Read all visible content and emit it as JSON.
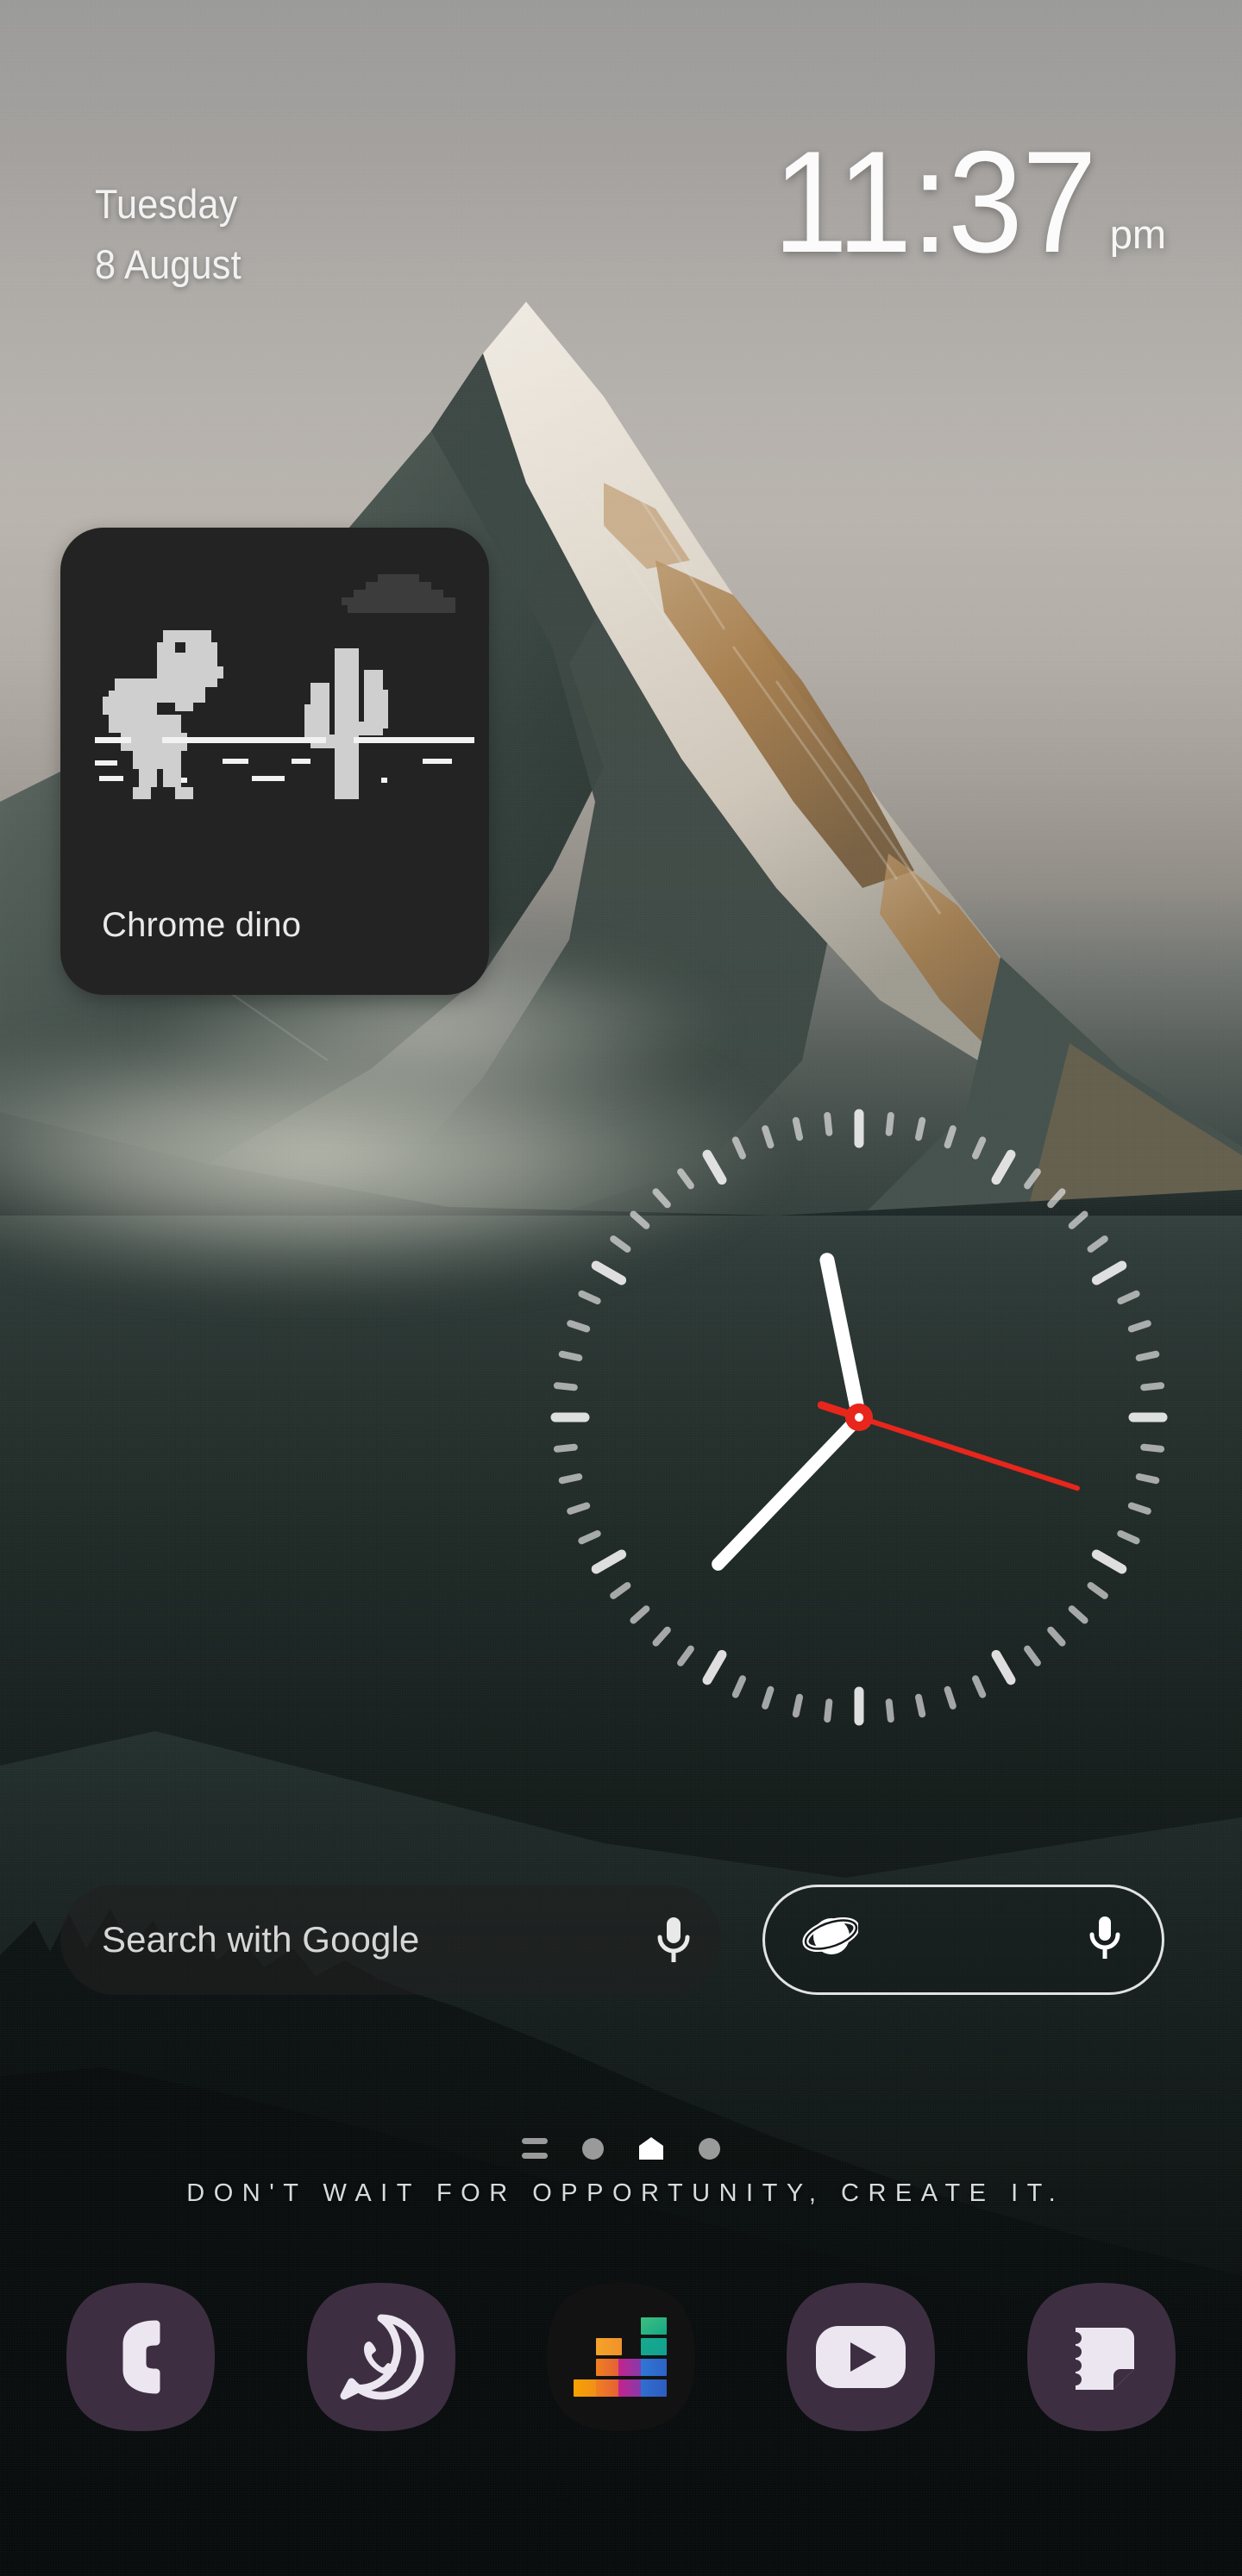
{
  "wallpaper": {
    "description": "mountain-peak-photo",
    "sky_color": "#b4b0ab",
    "forest_color": "#0d1615"
  },
  "status_clock": {
    "weekday": "Tuesday",
    "date": "8 August",
    "time": "11:37",
    "ampm": "pm"
  },
  "dino_widget": {
    "label": "Chrome dino",
    "background": "#232323",
    "sprite_color": "#cfcfcf"
  },
  "analog_clock": {
    "hour": 11,
    "minute": 37,
    "second": 18,
    "hand_color": "#ffffff",
    "second_hand_color": "#e8261c",
    "tick_color": "#e6e6e6"
  },
  "search": {
    "google_placeholder": "Search with Google",
    "google_mic_icon": "microphone-icon",
    "browser_icon": "samsung-internet-icon",
    "browser_mic_icon": "microphone-icon"
  },
  "page_indicator": {
    "items": [
      {
        "type": "app-list-bars",
        "active": false
      },
      {
        "type": "dot",
        "active": false
      },
      {
        "type": "home",
        "active": true
      },
      {
        "type": "dot",
        "active": false
      }
    ]
  },
  "quote": {
    "text": "DON'T WAIT FOR OPPORTUNITY, CREATE IT."
  },
  "dock": {
    "icon_bg": "#3d2f41",
    "glyph_color": "#ece6f0",
    "items": [
      {
        "name": "phone",
        "label": "Phone",
        "icon": "phone-icon"
      },
      {
        "name": "whatsapp",
        "label": "WhatsApp",
        "icon": "whatsapp-icon"
      },
      {
        "name": "deezer",
        "label": "Deezer",
        "icon": "deezer-icon"
      },
      {
        "name": "youtube",
        "label": "YouTube",
        "icon": "youtube-icon"
      },
      {
        "name": "notes",
        "label": "Samsung Notes",
        "icon": "notes-icon"
      }
    ]
  }
}
